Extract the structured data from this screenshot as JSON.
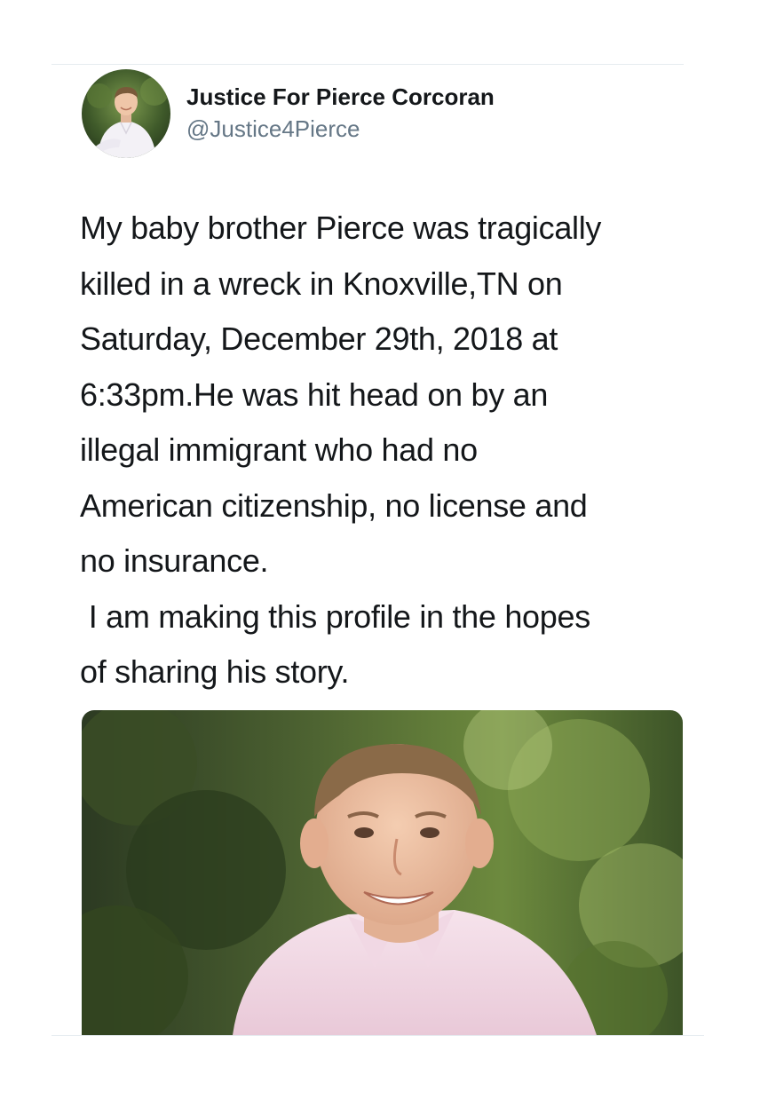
{
  "tweet": {
    "author": {
      "display_name": "Justice For Pierce Corcoran",
      "handle": "@Justice4Pierce",
      "avatar_icon": "profile-photo"
    },
    "text_lines": [
      "My baby brother Pierce was tragically",
      "killed in a wreck in Knoxville,TN on",
      "Saturday, December 29th, 2018 at",
      "6:33pm.He was hit head on by an",
      "illegal immigrant who had no",
      "American citizenship, no license and",
      "no insurance.",
      " I am making this profile in the hopes",
      "of sharing his story."
    ],
    "media": {
      "type": "photo"
    }
  },
  "colors": {
    "text_primary": "#14171a",
    "text_secondary": "#657786",
    "divider": "#e6ecf0",
    "background": "#ffffff"
  }
}
